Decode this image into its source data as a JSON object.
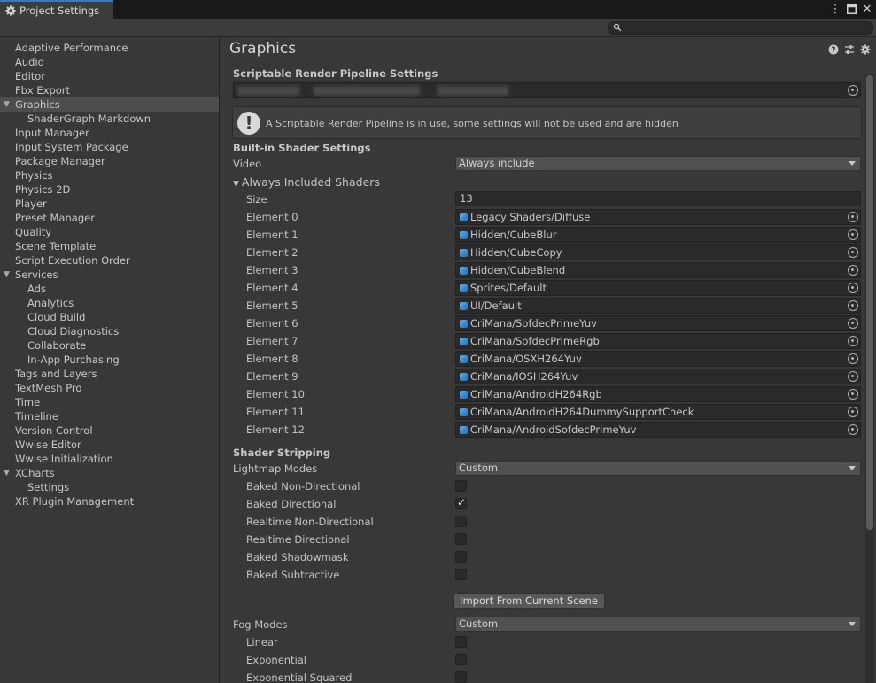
{
  "window": {
    "tab_title": "Project Settings",
    "icons": [
      "gear-icon",
      "kebab-menu-icon",
      "maximize-icon",
      "close-icon"
    ]
  },
  "search": {
    "placeholder": ""
  },
  "sidebar": {
    "items": [
      {
        "label": "Adaptive Performance",
        "indent": 0
      },
      {
        "label": "Audio",
        "indent": 0
      },
      {
        "label": "Editor",
        "indent": 0
      },
      {
        "label": "Fbx Export",
        "indent": 0
      },
      {
        "label": "Graphics",
        "indent": 0,
        "expanded": true,
        "selected": true
      },
      {
        "label": "ShaderGraph Markdown",
        "indent": 1
      },
      {
        "label": "Input Manager",
        "indent": 0
      },
      {
        "label": "Input System Package",
        "indent": 0
      },
      {
        "label": "Package Manager",
        "indent": 0
      },
      {
        "label": "Physics",
        "indent": 0
      },
      {
        "label": "Physics 2D",
        "indent": 0
      },
      {
        "label": "Player",
        "indent": 0
      },
      {
        "label": "Preset Manager",
        "indent": 0
      },
      {
        "label": "Quality",
        "indent": 0
      },
      {
        "label": "Scene Template",
        "indent": 0
      },
      {
        "label": "Script Execution Order",
        "indent": 0
      },
      {
        "label": "Services",
        "indent": 0,
        "expanded": true
      },
      {
        "label": "Ads",
        "indent": 1
      },
      {
        "label": "Analytics",
        "indent": 1
      },
      {
        "label": "Cloud Build",
        "indent": 1
      },
      {
        "label": "Cloud Diagnostics",
        "indent": 1
      },
      {
        "label": "Collaborate",
        "indent": 1
      },
      {
        "label": "In-App Purchasing",
        "indent": 1
      },
      {
        "label": "Tags and Layers",
        "indent": 0
      },
      {
        "label": "TextMesh Pro",
        "indent": 0
      },
      {
        "label": "Time",
        "indent": 0
      },
      {
        "label": "Timeline",
        "indent": 0
      },
      {
        "label": "Version Control",
        "indent": 0
      },
      {
        "label": "Wwise Editor",
        "indent": 0
      },
      {
        "label": "Wwise Initialization",
        "indent": 0
      },
      {
        "label": "XCharts",
        "indent": 0,
        "expanded": true
      },
      {
        "label": "Settings",
        "indent": 1
      },
      {
        "label": "XR Plugin Management",
        "indent": 0
      }
    ]
  },
  "main": {
    "title": "Graphics",
    "header_icons": [
      "help-icon",
      "presets-icon",
      "settings-icon"
    ],
    "srp_section": "Scriptable Render Pipeline Settings",
    "srp_warning": "A Scriptable Render Pipeline is in use, some settings will not be used and are hidden",
    "builtin_section": "Built-in Shader Settings",
    "video_label": "Video",
    "video_value": "Always include",
    "always_included_label": "Always Included Shaders",
    "size_label": "Size",
    "size_value": "13",
    "elements": [
      {
        "label": "Element 0",
        "value": "Legacy Shaders/Diffuse"
      },
      {
        "label": "Element 1",
        "value": "Hidden/CubeBlur"
      },
      {
        "label": "Element 2",
        "value": "Hidden/CubeCopy"
      },
      {
        "label": "Element 3",
        "value": "Hidden/CubeBlend"
      },
      {
        "label": "Element 4",
        "value": "Sprites/Default"
      },
      {
        "label": "Element 5",
        "value": "UI/Default"
      },
      {
        "label": "Element 6",
        "value": "CriMana/SofdecPrimeYuv"
      },
      {
        "label": "Element 7",
        "value": "CriMana/SofdecPrimeRgb"
      },
      {
        "label": "Element 8",
        "value": "CriMana/OSXH264Yuv"
      },
      {
        "label": "Element 9",
        "value": "CriMana/IOSH264Yuv"
      },
      {
        "label": "Element 10",
        "value": "CriMana/AndroidH264Rgb"
      },
      {
        "label": "Element 11",
        "value": "CriMana/AndroidH264DummySupportCheck"
      },
      {
        "label": "Element 12",
        "value": "CriMana/AndroidSofdecPrimeYuv"
      }
    ],
    "stripping_section": "Shader Stripping",
    "lightmap_label": "Lightmap Modes",
    "lightmap_value": "Custom",
    "lightmap_options": [
      {
        "label": "Baked Non-Directional",
        "checked": false
      },
      {
        "label": "Baked Directional",
        "checked": true
      },
      {
        "label": "Realtime Non-Directional",
        "checked": false
      },
      {
        "label": "Realtime Directional",
        "checked": false
      },
      {
        "label": "Baked Shadowmask",
        "checked": false
      },
      {
        "label": "Baked Subtractive",
        "checked": false
      }
    ],
    "import_button": "Import From Current Scene",
    "fog_label": "Fog Modes",
    "fog_value": "Custom",
    "fog_options": [
      {
        "label": "Linear",
        "checked": false
      },
      {
        "label": "Exponential",
        "checked": false
      },
      {
        "label": "Exponential Squared",
        "checked": false
      }
    ]
  }
}
